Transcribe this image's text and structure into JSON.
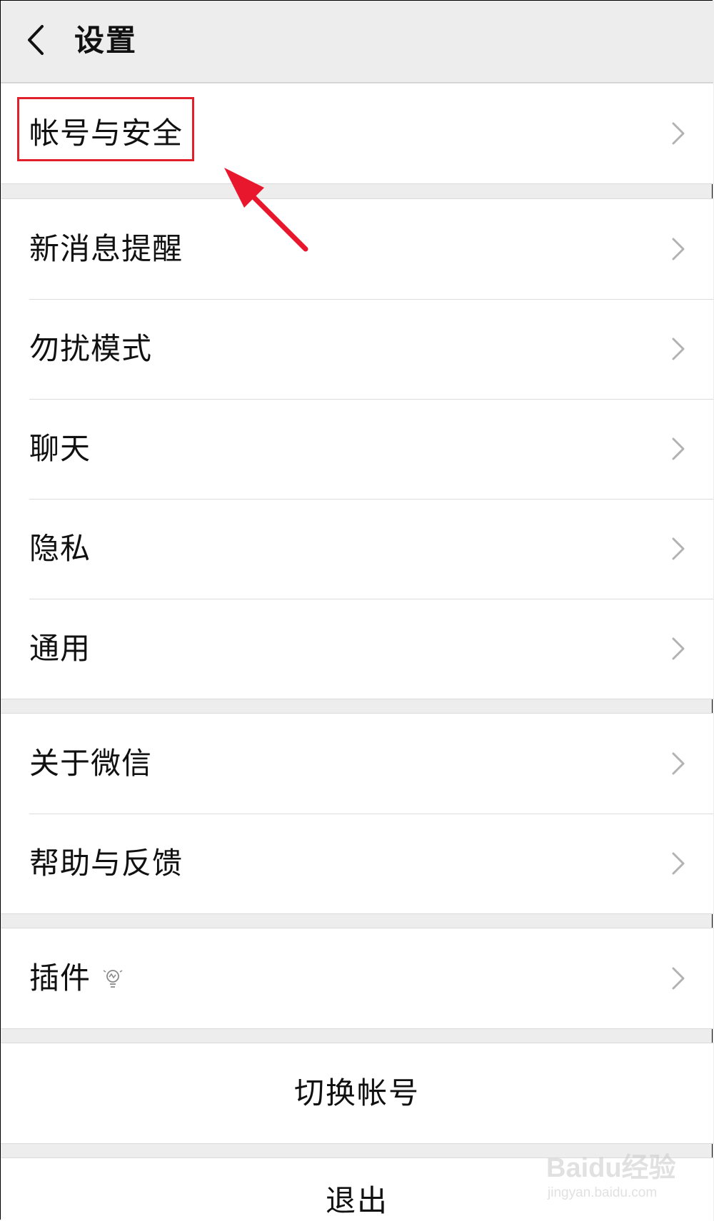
{
  "header": {
    "title": "设置",
    "back_icon": "chevron-left-icon"
  },
  "groups": [
    {
      "items": [
        {
          "label": "帐号与安全"
        }
      ]
    },
    {
      "items": [
        {
          "label": "新消息提醒"
        },
        {
          "label": "勿扰模式"
        },
        {
          "label": "聊天"
        },
        {
          "label": "隐私"
        },
        {
          "label": "通用"
        }
      ]
    },
    {
      "items": [
        {
          "label": "关于微信"
        },
        {
          "label": "帮助与反馈"
        }
      ]
    },
    {
      "items": [
        {
          "label": "插件",
          "icon": "lightbulb-icon"
        }
      ]
    }
  ],
  "actions": {
    "switch_account": "切换帐号",
    "logout": "退出"
  },
  "annotation": {
    "highlight_color": "#e0202a",
    "arrow_color": "#e8172d"
  },
  "watermark": {
    "brand": "Baidu经验",
    "url": "jingyan.baidu.com"
  }
}
